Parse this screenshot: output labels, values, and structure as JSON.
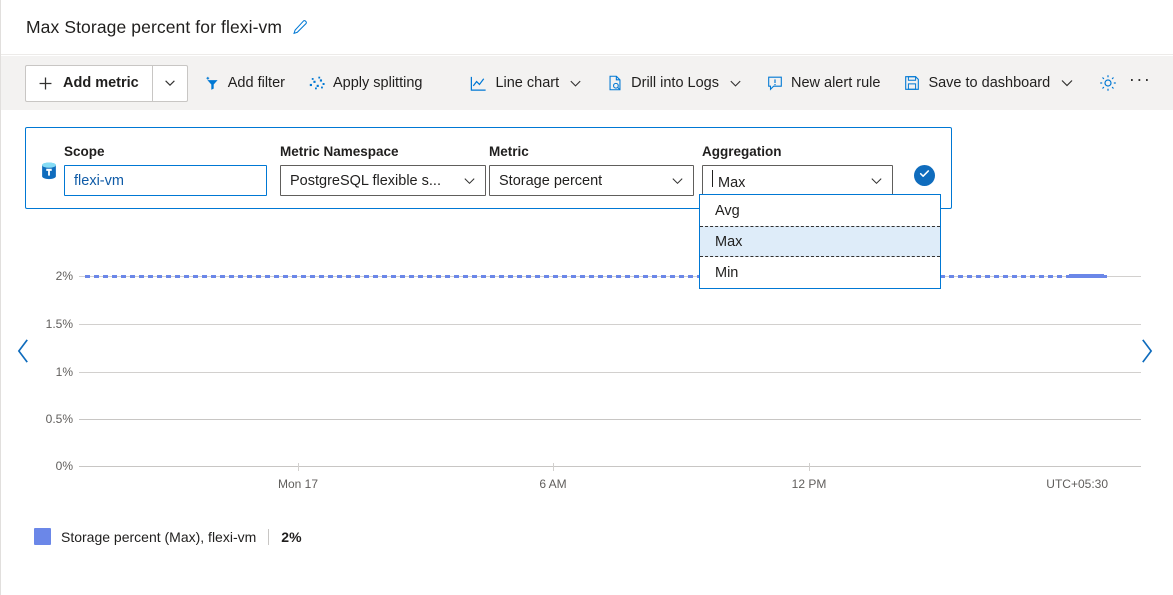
{
  "header": {
    "title": "Max Storage percent for flexi-vm",
    "edit_icon": "pencil-icon"
  },
  "toolbar": {
    "add_metric": {
      "label": "Add metric",
      "icon": "plus-icon",
      "caret": "chevron-down-icon"
    },
    "add_filter": {
      "label": "Add filter",
      "icon": "filter-add-icon"
    },
    "apply_splitting": {
      "label": "Apply splitting",
      "icon": "splitting-icon"
    },
    "chart_type": {
      "label": "Line chart",
      "icon": "line-chart-icon",
      "caret": "chevron-down-icon"
    },
    "drill_into_logs": {
      "label": "Drill into Logs",
      "icon": "logs-page-icon",
      "caret": "chevron-down-icon"
    },
    "new_alert_rule": {
      "label": "New alert rule",
      "icon": "alert-bell-icon"
    },
    "save_to_dashboard": {
      "label": "Save to dashboard",
      "icon": "save-floppy-icon",
      "caret": "chevron-down-icon"
    },
    "settings": {
      "icon": "gear-icon"
    },
    "more": {
      "label": "···",
      "icon": "ellipsis-icon"
    }
  },
  "selector": {
    "resource_icon": "postgresql-database-icon",
    "scope": {
      "label": "Scope",
      "value": "flexi-vm"
    },
    "namespace": {
      "label": "Metric Namespace",
      "value": "PostgreSQL flexible s...",
      "caret": "chevron-down-icon"
    },
    "metric": {
      "label": "Metric",
      "value": "Storage percent",
      "caret": "chevron-down-icon"
    },
    "aggregation": {
      "label": "Aggregation",
      "value": "Max",
      "caret": "chevron-down-icon"
    },
    "confirm": {
      "icon": "check-circle-icon"
    }
  },
  "aggregation_dropdown": {
    "options": [
      "Avg",
      "Max",
      "Min"
    ],
    "selected": "Max"
  },
  "nav": {
    "prev": "chevron-left-icon",
    "next": "chevron-right-icon"
  },
  "chart_data": {
    "type": "line",
    "title": "Max Storage percent for flexi-vm",
    "xlabel": "",
    "ylabel": "",
    "ytick_labels": [
      "2%",
      "1.5%",
      "1%",
      "0.5%",
      "0%"
    ],
    "ytick_values": [
      2,
      1.5,
      1,
      0.5,
      0
    ],
    "ylim": [
      0,
      2
    ],
    "xtick_labels": [
      "Mon 17",
      "6 AM",
      "12 PM"
    ],
    "timezone": "UTC+05:30",
    "grid": true,
    "legend_position": "bottom-left",
    "series": [
      {
        "name": "Storage percent (Max), flexi-vm",
        "color": "#6b87e8",
        "current_value": "2%",
        "x": [
          "Mon 17 00:00",
          "Mon 17 03:00",
          "Mon 17 06:00",
          "Mon 17 09:00",
          "Mon 17 12:00",
          "Mon 17 15:00",
          "Mon 17 18:00",
          "Mon 17 21:00"
        ],
        "values": [
          2,
          2,
          2,
          2,
          2,
          2,
          2,
          2
        ]
      }
    ]
  },
  "legend": {
    "swatch_color": "#6b87e8",
    "label": "Storage percent (Max), flexi-vm",
    "value": "2%"
  }
}
